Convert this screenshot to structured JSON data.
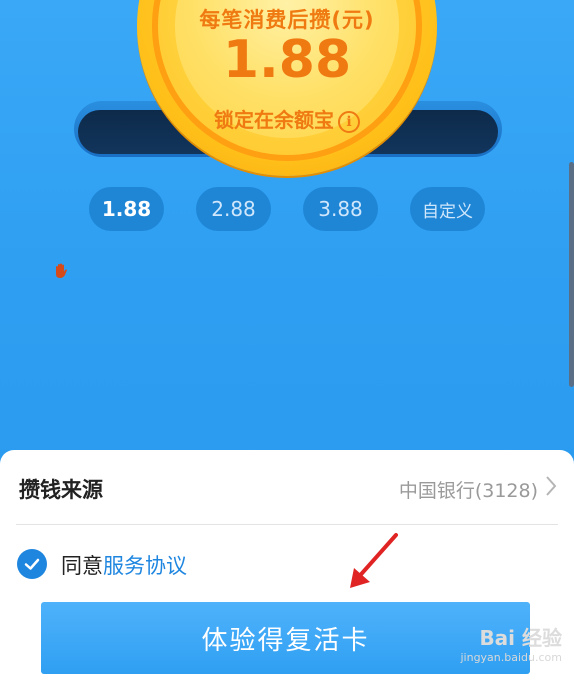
{
  "coin": {
    "title": "每笔消费后攒(元)",
    "amount": "1.88",
    "subtitle": "锁定在余额宝",
    "info_glyph": "i"
  },
  "amount_options": [
    {
      "label": "1.88",
      "selected": true
    },
    {
      "label": "2.88",
      "selected": false
    },
    {
      "label": "3.88",
      "selected": false
    },
    {
      "label": "自定义",
      "selected": false
    }
  ],
  "sheet": {
    "source_label": "攒钱来源",
    "source_value": "中国银行(3128)",
    "agree_prefix": "同意",
    "agree_link": "服务协议",
    "agree_checked": true,
    "cta_label": "体验得复活卡"
  },
  "watermark": {
    "brand": "Bai 经验",
    "url": "jingyan.baidu.com"
  },
  "colors": {
    "background": "#2f9ff2",
    "coin_text": "#f07a12",
    "link": "#1f86e0",
    "annotation_arrow": "#e02424"
  }
}
